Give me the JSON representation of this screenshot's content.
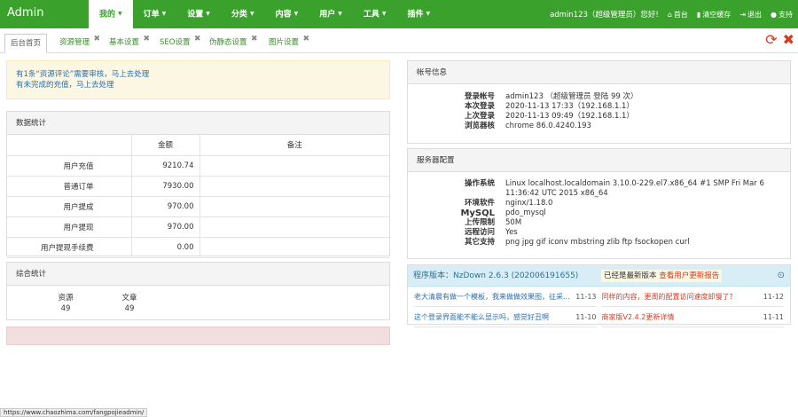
{
  "brand": "Admin",
  "nav": [
    "我的",
    "订单",
    "设置",
    "分类",
    "内容",
    "用户",
    "工具",
    "插件"
  ],
  "user_info": "admin123（超级管理员）您好!",
  "right_nav": {
    "home": "首台",
    "cache": "清空缓存",
    "logout": "退出",
    "support": "支持"
  },
  "tabs": [
    "后台首页",
    "资源管理",
    "基本设置",
    "SEO设置",
    "伪静态设置",
    "图片设置"
  ],
  "alert": [
    "有1条“资源评论”需要审核，马上去处理",
    "有未完成的充值，马上去处理"
  ],
  "stats": {
    "title": "数据统计",
    "headers": [
      "",
      "金额",
      "备注"
    ],
    "rows": [
      {
        "label": "用户充值",
        "amount": "9210.74",
        "note": ""
      },
      {
        "label": "普通订单",
        "amount": "7930.00",
        "note": ""
      },
      {
        "label": "用户提成",
        "amount": "970.00",
        "note": ""
      },
      {
        "label": "用户提现",
        "amount": "970.00",
        "note": ""
      },
      {
        "label": "用户提现手续费",
        "amount": "0.00",
        "note": ""
      }
    ]
  },
  "overall": {
    "title": "综合统计",
    "items": [
      {
        "label": "资源",
        "value": "49"
      },
      {
        "label": "文章",
        "value": "49"
      }
    ]
  },
  "account": {
    "title": "帐号信息",
    "rows": [
      {
        "k": "登录帐号",
        "v": "admin123 （超级管理员 登陆 99 次）"
      },
      {
        "k": "本次登录",
        "v": "2020-11-13 17:33（192.168.1.1）"
      },
      {
        "k": "上次登录",
        "v": "2020-11-13 09:49（192.168.1.1）"
      },
      {
        "k": "浏览器核",
        "v": "chrome 86.0.4240.193"
      }
    ]
  },
  "server": {
    "title": "服务器配置",
    "rows": [
      {
        "k": "操作系统",
        "v": "Linux localhost.localdomain 3.10.0-229.el7.x86_64 #1 SMP Fri Mar 6 11:36:42 UTC 2015 x86_64"
      },
      {
        "k": "环境软件",
        "v": "nginx/1.18.0"
      },
      {
        "k": "MySQL",
        "v": "pdo_mysql"
      },
      {
        "k": "上传限制",
        "v": "50M"
      },
      {
        "k": "远程访问",
        "v": "Yes"
      },
      {
        "k": "其它支持",
        "v": "png jpg gif iconv mbstring zlib ftp fsockopen curl"
      }
    ]
  },
  "version": {
    "label": "程序版本：NzDown 2.6.3 (202006191655)",
    "latest": "已经是最新版本",
    "link": "查看用户更新报告",
    "news_left": [
      {
        "t": "老大清晨有做一个模板，我来做做效果图，征采...",
        "d": "11-13"
      },
      {
        "t": "这个登录界面能不能么显示吗，感觉好丑啊",
        "d": "11-10"
      }
    ],
    "news_right": [
      {
        "t": "同样的内容，更周的配置访问速度卸慢了？",
        "d": "11-12"
      },
      {
        "t": "商家版V2.4.2更新详情",
        "d": "11-11"
      }
    ]
  },
  "status_url": "https://www.chaozhima.com/fangpojieadmin/"
}
